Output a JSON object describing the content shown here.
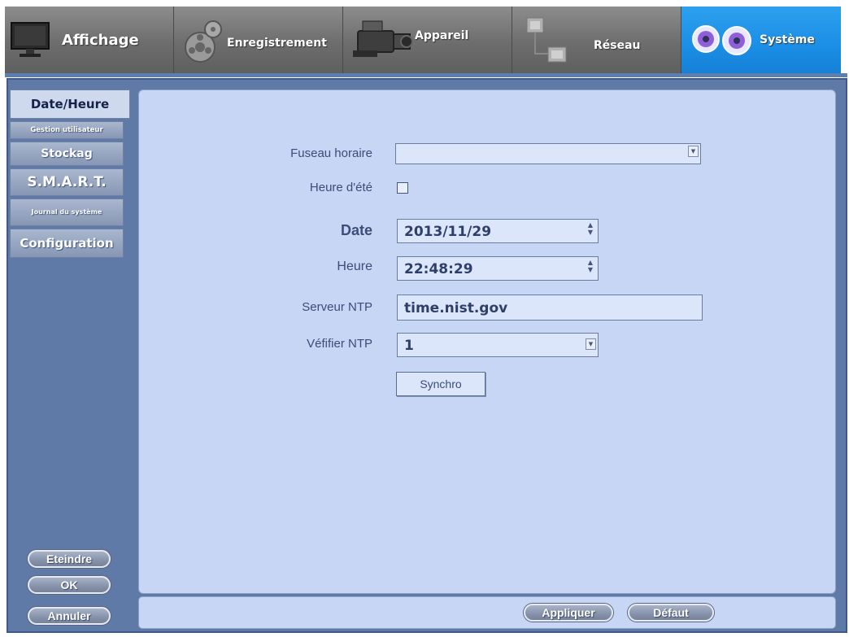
{
  "tabs": [
    {
      "label": "Affichage",
      "icon": "monitor-icon",
      "active": false
    },
    {
      "label": "Enregistrement",
      "icon": "film-reel-icon",
      "active": false
    },
    {
      "label": "Appareil",
      "icon": "camcorder-icon",
      "active": false
    },
    {
      "label": "Réseau",
      "icon": "network-icon",
      "active": false
    },
    {
      "label": "Système",
      "icon": "gears-icon",
      "active": true
    }
  ],
  "sidebar": {
    "items": [
      {
        "label": "Date/Heure",
        "active": true
      },
      {
        "label": "Gestion utilisateur",
        "active": false
      },
      {
        "label": "Stockag",
        "active": false
      },
      {
        "label": "S.M.A.R.T.",
        "active": false
      },
      {
        "label": "Journal du système",
        "active": false
      },
      {
        "label": "Configuration",
        "active": false
      }
    ],
    "buttons": {
      "shutdown": "Eteindre",
      "ok": "OK",
      "cancel": "Annuler"
    }
  },
  "form": {
    "timezone": {
      "label": "Fuseau horaire",
      "value": ""
    },
    "dst": {
      "label": "Heure d'été",
      "checked": false
    },
    "date": {
      "label": "Date",
      "value": "2013/11/29"
    },
    "time": {
      "label": "Heure",
      "value": "22:48:29"
    },
    "ntp_server": {
      "label": "Serveur NTP",
      "value": "time.nist.gov"
    },
    "ntp_check": {
      "label": "Véfifier NTP",
      "value": "1"
    },
    "sync_button": "Synchro"
  },
  "footer": {
    "apply": "Appliquer",
    "default": "Défaut"
  },
  "colors": {
    "active_tab": "#1b8ee6",
    "panel_bg": "#c7d6f4",
    "frame": "#5f7aa6"
  }
}
